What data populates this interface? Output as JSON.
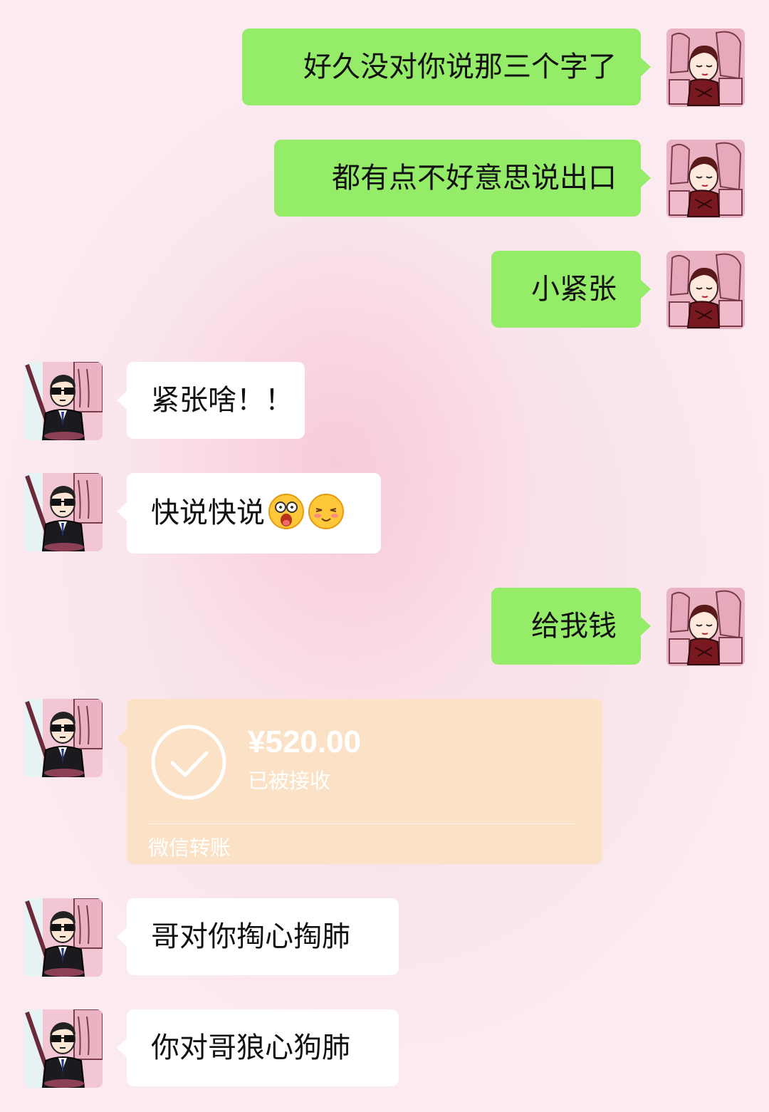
{
  "messages": [
    {
      "side": "me",
      "text": "好久没对你说那三个字了"
    },
    {
      "side": "me",
      "text": "都有点不好意思说出口"
    },
    {
      "side": "me",
      "text": "小紧张"
    },
    {
      "side": "other",
      "text": "紧张啥！！"
    },
    {
      "side": "other",
      "text": "快说快说",
      "emojis": [
        "surprised-emoji",
        "shy-emoji"
      ]
    },
    {
      "side": "me",
      "text": "给我钱"
    },
    {
      "side": "other",
      "type": "transfer"
    },
    {
      "side": "other",
      "text": "哥对你掏心掏肺"
    },
    {
      "side": "other",
      "text": "你对哥狼心狗肺"
    }
  ],
  "transfer": {
    "amount": "¥520.00",
    "status": "已被接收",
    "footer": "微信转账",
    "icon": "check-circle-icon"
  },
  "colors": {
    "my_bubble": "#95ec69",
    "other_bubble": "#ffffff",
    "transfer_card": "#fbe1c5"
  }
}
